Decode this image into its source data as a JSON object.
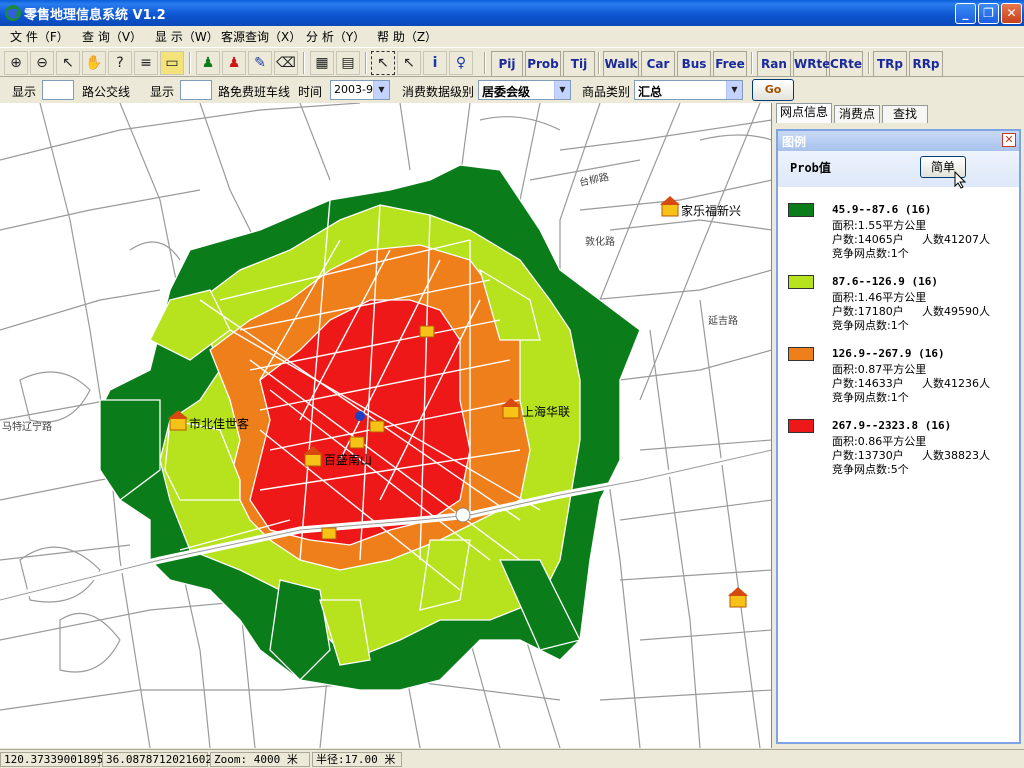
{
  "window": {
    "title": "零售地理信息系统 V1.2"
  },
  "menu": [
    "文 件（F）",
    "查 询（V）",
    "显 示（W）",
    "客源查询（X）",
    "分 析（Y）",
    "帮 助（Z）"
  ],
  "toolbar": {
    "icons": [
      "zoom-in-icon",
      "zoom-out-icon",
      "pointer-icon",
      "pan-hand-icon",
      "help-cursor-icon",
      "layers-icon",
      "map-frame-icon",
      "pin-green-icon",
      "pin-red-icon",
      "pin-blue-icon",
      "eraser-icon",
      "table-icon",
      "report-icon",
      "select-rect-icon",
      "arrow-icon",
      "info-icon",
      "person-icon"
    ],
    "text_buttons": [
      "Pij",
      "Prob",
      "Tij",
      "Walk",
      "Car",
      "Bus",
      "Free",
      "Ran",
      "WRte",
      "CRte",
      "TRp",
      "RRp"
    ]
  },
  "filters": {
    "show1_label": "显示",
    "bus_label": "路公交线",
    "show2_label": "显示",
    "freebus_label": "路免费班车线",
    "time_label": "时间",
    "time_value": "2003-9",
    "level_label": "消费数据级别",
    "level_value": "居委会级",
    "category_label": "商品类别",
    "category_value": "汇总",
    "go_label": "Go"
  },
  "tabs": [
    "网点信息",
    "消费点",
    "查找"
  ],
  "legend": {
    "header": "图例",
    "title": "Prob值",
    "simple_button": "简单",
    "items": [
      {
        "color": "#0a7d1a",
        "range": "45.9--87.6 (16)",
        "area": "面积:1.55平方公里",
        "households": "户数:14065户",
        "population": "人数41207人",
        "competitors": "竞争网点数:1个"
      },
      {
        "color": "#b6e31e",
        "range": "87.6--126.9 (16)",
        "area": "面积:1.46平方公里",
        "households": "户数:17180户",
        "population": "人数49590人",
        "competitors": "竞争网点数:1个"
      },
      {
        "color": "#ef7f1a",
        "range": "126.9--267.9 (16)",
        "area": "面积:0.87平方公里",
        "households": "户数:14633户",
        "population": "人数41236人",
        "competitors": "竞争网点数:1个"
      },
      {
        "color": "#ee1818",
        "range": "267.9--2323.8 (16)",
        "area": "面积:0.86平方公里",
        "households": "户数:13730户",
        "population": "人数38823人",
        "competitors": "竞争网点数:5个"
      }
    ]
  },
  "map": {
    "pois": [
      "家乐福新兴",
      "上海华联",
      "市北佳世客",
      "百盛南山"
    ],
    "roads": [
      "敦化路",
      "延吉路",
      "马特辽宁路",
      "台柳路"
    ]
  },
  "status": {
    "x": "120.37339001895",
    "y": "36.0878712021602",
    "zoom_label": "Zoom:",
    "zoom_value": "4000 米",
    "radius": "半径:17.00 米"
  }
}
